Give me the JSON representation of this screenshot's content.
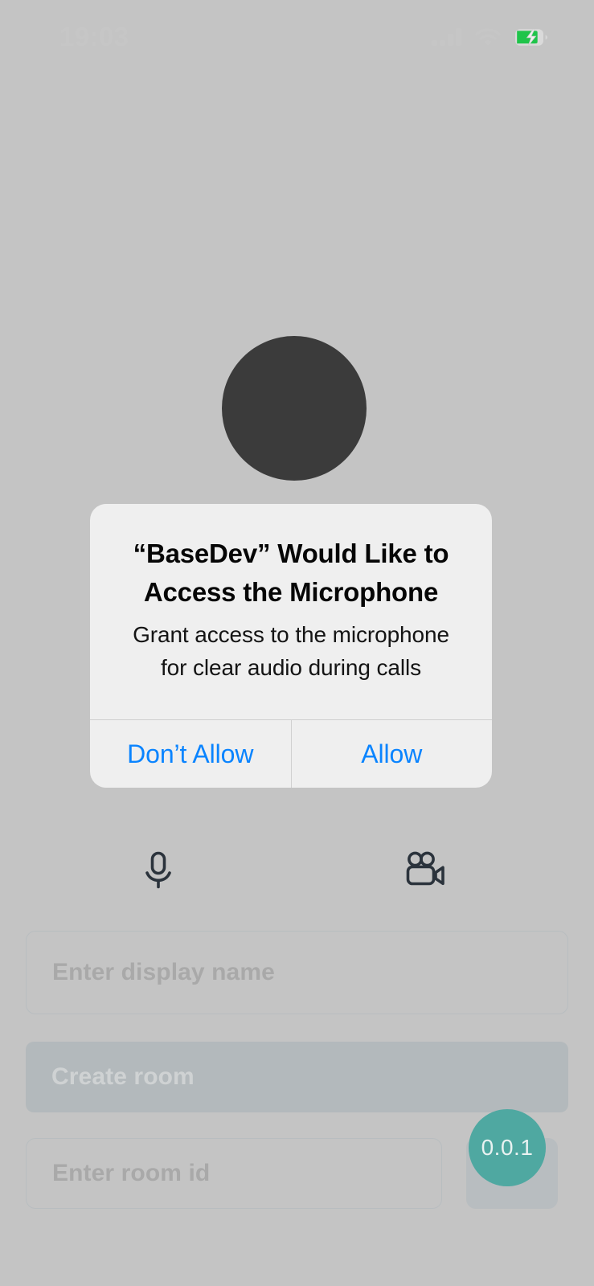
{
  "status_bar": {
    "time": "19:03",
    "icons": {
      "signal": "cellular-signal-icon",
      "wifi": "wifi-icon",
      "battery": "battery-charging-icon"
    }
  },
  "app": {
    "video_placeholder": "local-video-avatar",
    "media_controls": [
      {
        "name": "microphone-toggle",
        "icon": "microphone-icon"
      },
      {
        "name": "camera-toggle",
        "icon": "video-camera-icon"
      }
    ],
    "display_name_field": {
      "placeholder": "Enter display name",
      "value": ""
    },
    "create_room_button": {
      "label": "Create room"
    },
    "room_id_field": {
      "placeholder": "Enter room id",
      "value": ""
    },
    "join_room_button": {
      "label": ""
    },
    "version_badge": {
      "label": "0.0.1",
      "color": "#4fa8a1"
    }
  },
  "permission_alert": {
    "title": "“BaseDev” Would Like to Access the Microphone",
    "message": "Grant access to the microphone for clear audio during calls",
    "buttons": {
      "deny": "Don’t Allow",
      "allow": "Allow"
    },
    "accent_color": "#0a84ff"
  }
}
